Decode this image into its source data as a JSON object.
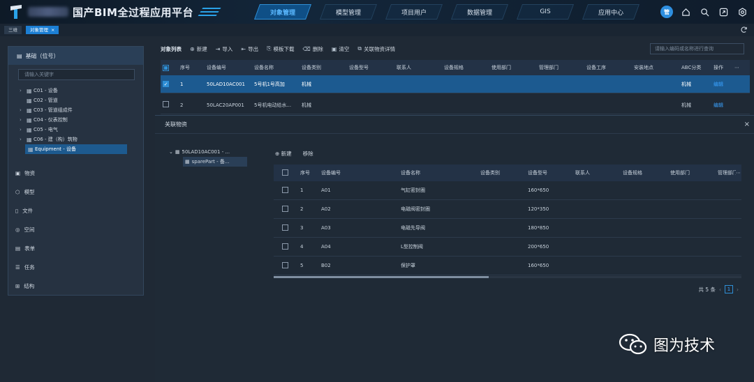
{
  "app": {
    "title": "国产BIM全过程应用平台"
  },
  "nav": [
    {
      "label": "对象管理",
      "active": true
    },
    {
      "label": "模型管理",
      "active": false
    },
    {
      "label": "项目用户",
      "active": false
    },
    {
      "label": "数据管理",
      "active": false
    },
    {
      "label": "GIS",
      "active": false
    },
    {
      "label": "应用中心",
      "active": false
    }
  ],
  "header_icons": [
    "user-badge-icon",
    "home-icon",
    "search-icon",
    "fullscreen-icon",
    "settings-icon"
  ],
  "user_badge": "管",
  "tabs": [
    {
      "label": "三维"
    },
    {
      "label": "对象管理",
      "active": true,
      "close": "×"
    }
  ],
  "sidebar": {
    "header": "基础（位号）",
    "search_placeholder": "请输入关键字",
    "tree": [
      {
        "label": "C01 - 设备",
        "expandable": true
      },
      {
        "label": "C02 - 管道",
        "expandable": false
      },
      {
        "label": "C03 - 管道组成件",
        "expandable": true
      },
      {
        "label": "C04 - 仪表控制",
        "expandable": true
      },
      {
        "label": "C05 - 电气",
        "expandable": true
      },
      {
        "label": "C06 - 建（构）筑物",
        "expandable": true
      },
      {
        "label": "Equipment - 设备",
        "expandable": false,
        "selected": true
      }
    ],
    "menu": [
      "物资",
      "模型",
      "文件",
      "空间",
      "表单",
      "任务",
      "结构"
    ]
  },
  "toolbar": {
    "title": "对象列表",
    "buttons": [
      "新建",
      "导入",
      "导出",
      "模板下载",
      "删除",
      "清空",
      "关联物资详情"
    ],
    "search_placeholder": "请输入编码或名称进行查询"
  },
  "grid": {
    "columns": [
      "序号",
      "设备编号",
      "设备名称",
      "设备类别",
      "设备型号",
      "联系人",
      "设备规格",
      "使用部门",
      "管理部门",
      "设备工序",
      "安装地点",
      "ABC分类",
      "操作"
    ],
    "more": "⋯",
    "rows": [
      {
        "no": "1",
        "code": "50LAD10AC001",
        "name": "5号机1号高加",
        "category": "机械",
        "abc": "机械",
        "action": "编辑",
        "selected": true
      },
      {
        "no": "2",
        "code": "50LAC20AP001",
        "name": "5号机电动给水...",
        "category": "机械",
        "abc": "机械",
        "action": "编辑",
        "selected": false
      }
    ]
  },
  "dialog": {
    "title": "关联物资",
    "close": "×",
    "tree_root": "50LAD10AC001 - ...",
    "tree_child": "sparePart - 备...",
    "tools": [
      "新建",
      "移除"
    ],
    "columns": [
      "序号",
      "设备编号",
      "设备名称",
      "设备类别",
      "设备型号",
      "联系人",
      "设备规格",
      "使用部门",
      "管理部门"
    ],
    "more": "⋯",
    "rows": [
      {
        "no": "1",
        "code": "A01",
        "name": "气缸密封圈",
        "model": "160*650"
      },
      {
        "no": "2",
        "code": "A02",
        "name": "电磁阀密封圈",
        "model": "120*350"
      },
      {
        "no": "3",
        "code": "A03",
        "name": "电磁先导阀",
        "model": "180*850"
      },
      {
        "no": "4",
        "code": "A04",
        "name": "L型控制阀",
        "model": "200*650"
      },
      {
        "no": "5",
        "code": "B02",
        "name": "保护罩",
        "model": "160*650"
      }
    ],
    "pager": {
      "total": "共 5 条",
      "page": "1",
      "prev": "‹",
      "next": "›"
    }
  },
  "watermark": "图为技术"
}
